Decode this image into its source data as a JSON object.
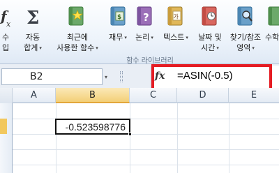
{
  "ribbon": {
    "buttons": [
      {
        "id": "insert-function",
        "line1": "수",
        "line2": "입"
      },
      {
        "id": "autosum",
        "line1": "자동",
        "line2": "합계"
      },
      {
        "id": "recently-used",
        "line1": "최근에",
        "line2": "사용한 함수"
      },
      {
        "id": "financial",
        "line1": "재무",
        "line2": ""
      },
      {
        "id": "logical",
        "line1": "논리",
        "line2": ""
      },
      {
        "id": "text",
        "line1": "텍스트",
        "line2": ""
      },
      {
        "id": "date-time",
        "line1": "날짜 및",
        "line2": "시간"
      },
      {
        "id": "lookup-reference",
        "line1": "찾기/참조",
        "line2": "영역"
      },
      {
        "id": "math-trig",
        "line1": "수학",
        "line2": ""
      }
    ],
    "group_label": "함수 라이브러리",
    "icon_glyphs": {
      "sigma": "Σ",
      "fx": "fx",
      "question": "?",
      "text": "가"
    },
    "dropdown_glyph": "▾"
  },
  "formula_bar": {
    "name_box": "B2",
    "fx_label": "fx",
    "formula": "=ASIN(-0.5)"
  },
  "sheet": {
    "columns": [
      "A",
      "B",
      "C",
      "D",
      "E"
    ],
    "selected_column": "B",
    "active_cell_value": "-0.523598776"
  },
  "colors": {
    "highlight": "#e51c23",
    "selected_header": "#f3cf77"
  }
}
